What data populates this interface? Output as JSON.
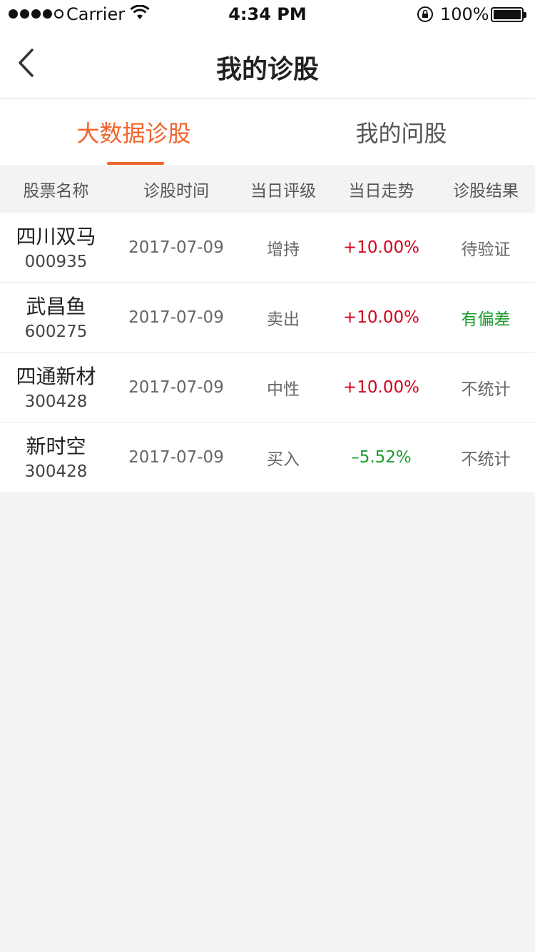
{
  "status_bar": {
    "carrier": "Carrier",
    "time": "4:34 PM",
    "battery": "100%"
  },
  "nav": {
    "title": "我的诊股",
    "back_icon": "chevron-left-icon"
  },
  "tabs": [
    {
      "label": "大数据诊股",
      "active": true
    },
    {
      "label": "我的问股",
      "active": false
    }
  ],
  "table": {
    "headers": [
      "股票名称",
      "诊股时间",
      "当日评级",
      "当日走势",
      "诊股结果"
    ],
    "rows": [
      {
        "name": "四川双马",
        "code": "000935",
        "date": "2017-07-09",
        "rating": "增持",
        "trend": "+10.00%",
        "trend_dir": "up",
        "result": "待验证",
        "result_color": "#666666"
      },
      {
        "name": "武昌鱼",
        "code": "600275",
        "date": "2017-07-09",
        "rating": "卖出",
        "trend": "+10.00%",
        "trend_dir": "up",
        "result": "有偏差",
        "result_color": "#1a9b2b"
      },
      {
        "name": "四通新材",
        "code": "300428",
        "date": "2017-07-09",
        "rating": "中性",
        "trend": "+10.00%",
        "trend_dir": "up",
        "result": "不统计",
        "result_color": "#666666"
      },
      {
        "name": "新时空",
        "code": "300428",
        "date": "2017-07-09",
        "rating": "买入",
        "trend": "–5.52%",
        "trend_dir": "down",
        "result": "不统计",
        "result_color": "#666666"
      }
    ]
  },
  "colors": {
    "accent": "#f0642d",
    "up": "#d0021b",
    "down": "#1a9b2b",
    "background": "#f3f3f3"
  }
}
